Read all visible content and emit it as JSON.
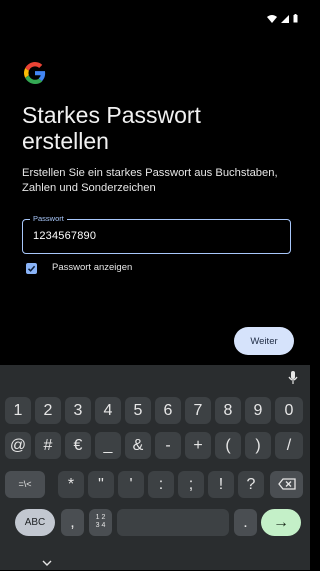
{
  "status_icons": [
    "wifi-icon",
    "signal-icon",
    "battery-icon"
  ],
  "title": "Starkes Passwort erstellen",
  "subtitle": "Erstellen Sie ein starkes Passwort aus Buchstaben, Zahlen und Sonderzeichen",
  "password_field": {
    "label": "Passwort",
    "value": "1234567890"
  },
  "show_password": {
    "label": "Passwort anzeigen",
    "checked": true
  },
  "next_button": "Weiter",
  "keyboard": {
    "row1": [
      "1",
      "2",
      "3",
      "4",
      "5",
      "6",
      "7",
      "8",
      "9",
      "0"
    ],
    "row2": [
      "@",
      "#",
      "€",
      "_",
      "&",
      "-",
      "+",
      "(",
      ")",
      "/"
    ],
    "row3": [
      "=\\<",
      "*",
      "\"",
      "'",
      ":",
      ";",
      "!",
      "?"
    ],
    "abc": "ABC",
    "comma": ",",
    "frac_top": "1 2",
    "frac_bottom": "3 4",
    "period": ".",
    "enter": "→"
  },
  "colors": {
    "accent": "#a8c7fa",
    "enter_key": "#c4f0c8",
    "keyboard_bg": "#2a2d2f"
  }
}
